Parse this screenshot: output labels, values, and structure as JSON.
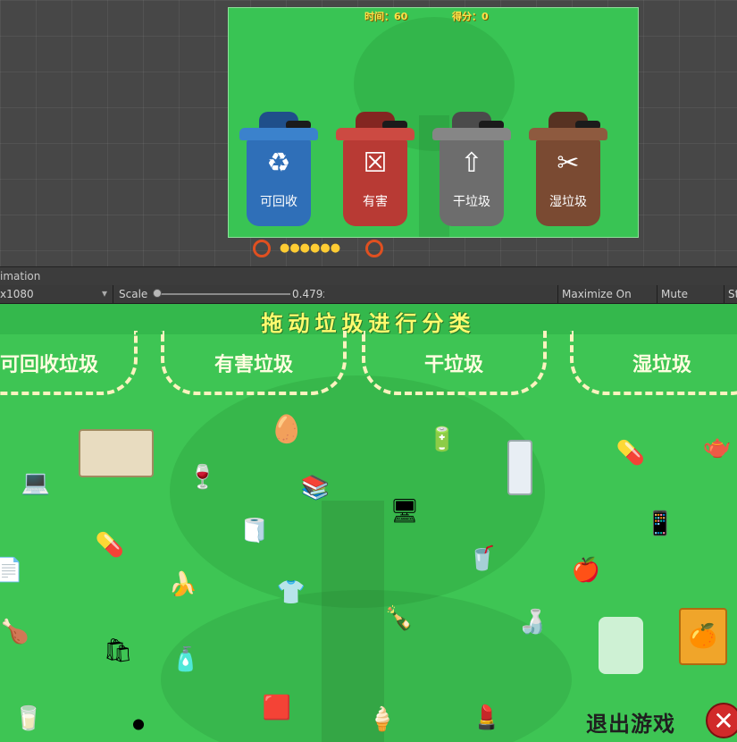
{
  "scene": {
    "hud_time": "时间：60",
    "hud_score": "得分：0",
    "bins": [
      {
        "label": "可回收",
        "color": "#2f6fb8",
        "dark": "#1f4f8a",
        "symbol": "♻"
      },
      {
        "label": "有害",
        "color": "#b83a34",
        "dark": "#842621",
        "symbol": "☒"
      },
      {
        "label": "干垃圾",
        "color": "#6d6d6d",
        "dark": "#4b4b4b",
        "symbol": "⇧"
      },
      {
        "label": "湿垃圾",
        "color": "#7a4a32",
        "dark": "#573222",
        "symbol": "✂"
      }
    ]
  },
  "editor": {
    "tab_label": "imation",
    "resolution": "x1080",
    "scale_label": "Scale",
    "scale_value": "0.479x",
    "maximize_label": "Maximize On Play",
    "mute_label": "Mute Audio",
    "stats_label": "St"
  },
  "game": {
    "title": "拖动垃圾进行分类",
    "zones": [
      "可回收垃圾",
      "有害垃圾",
      "干垃圾",
      "湿垃圾"
    ],
    "exit_label": "退出游戏",
    "exit_icon": "close-icon"
  }
}
